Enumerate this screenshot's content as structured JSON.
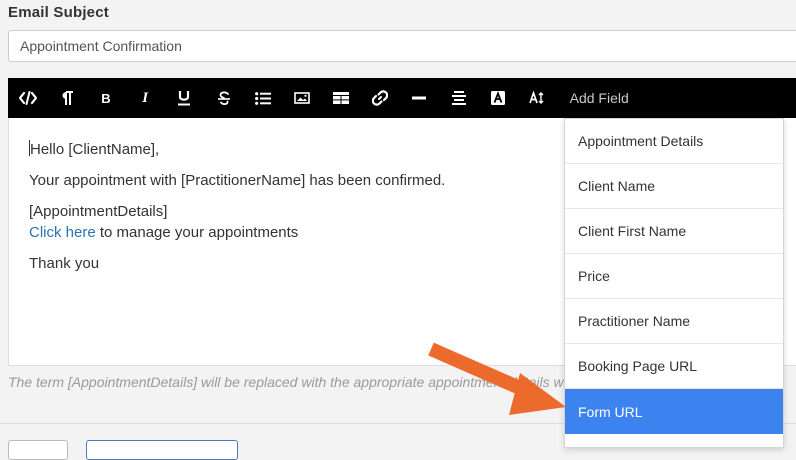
{
  "subject": {
    "label": "Email Subject",
    "value": "Appointment Confirmation"
  },
  "toolbar": {
    "buttons": [
      {
        "name": "code-view-button",
        "icon": "code-icon"
      },
      {
        "name": "paragraph-button",
        "icon": "pilcrow-icon"
      },
      {
        "name": "bold-button",
        "icon": "bold-icon",
        "text": "B"
      },
      {
        "name": "italic-button",
        "icon": "italic-icon",
        "text": "I"
      },
      {
        "name": "underline-button",
        "icon": "underline-icon"
      },
      {
        "name": "strikethrough-button",
        "icon": "strikethrough-icon"
      },
      {
        "name": "bullet-list-button",
        "icon": "list-icon"
      },
      {
        "name": "insert-image-button",
        "icon": "image-icon"
      },
      {
        "name": "insert-table-button",
        "icon": "table-icon"
      },
      {
        "name": "insert-link-button",
        "icon": "link-icon"
      },
      {
        "name": "horizontal-rule-button",
        "icon": "horizontal-rule-icon"
      },
      {
        "name": "align-button",
        "icon": "align-center-icon"
      },
      {
        "name": "font-color-button",
        "icon": "font-color-icon"
      },
      {
        "name": "font-size-button",
        "icon": "font-size-icon"
      }
    ],
    "add_field_label": "Add Field"
  },
  "editor": {
    "greeting": "Hello [ClientName],",
    "line1": "Your appointment with [PractitionerName] has been confirmed.",
    "details": "[AppointmentDetails]",
    "link_text": "Click here",
    "link_suffix": " to manage your appointments",
    "closing": "Thank you"
  },
  "help_text": "The term [AppointmentDetails] will be replaced with the appropriate appointment details when the email is sent to the client",
  "add_field_menu": {
    "items": [
      {
        "label": "Appointment Details",
        "active": false
      },
      {
        "label": "Client Name",
        "active": false
      },
      {
        "label": "Client First Name",
        "active": false
      },
      {
        "label": "Price",
        "active": false
      },
      {
        "label": "Practitioner Name",
        "active": false
      },
      {
        "label": "Booking Page URL",
        "active": false
      },
      {
        "label": "Form URL",
        "active": true
      }
    ]
  },
  "colors": {
    "toolbar_bg": "#000000",
    "menu_active": "#3c83f0",
    "link": "#2a72b5",
    "annotation_arrow": "#ec6a2c"
  }
}
